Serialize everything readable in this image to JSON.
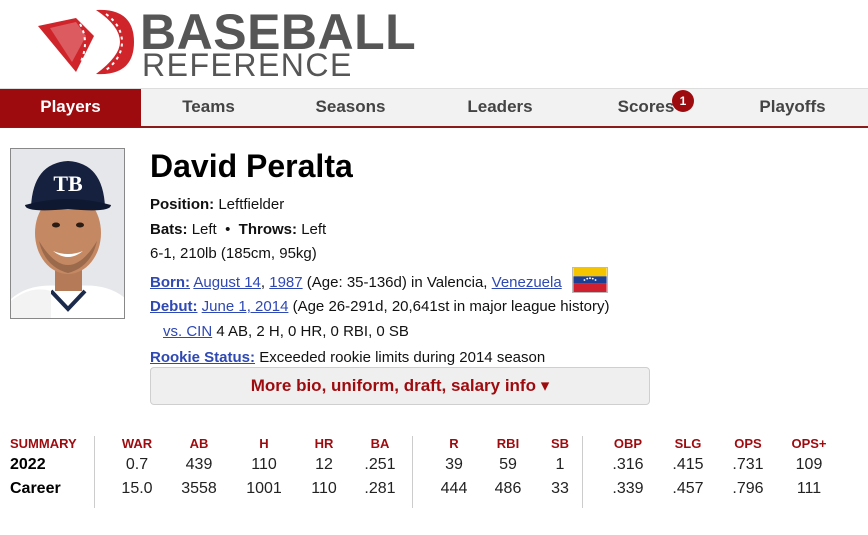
{
  "logo": {
    "line1": "BASEBALL",
    "line2": "REFERENCE",
    "brand_color": "#d0242b"
  },
  "nav": {
    "items": [
      {
        "label": "Players"
      },
      {
        "label": "Teams"
      },
      {
        "label": "Seasons"
      },
      {
        "label": "Leaders"
      },
      {
        "label": "Scores",
        "badge": "1"
      },
      {
        "label": "Playoffs"
      }
    ]
  },
  "player": {
    "name": "David Peralta",
    "position_label": "Position:",
    "position": "Leftfielder",
    "bats_label": "Bats:",
    "bats": "Left",
    "separator": "•",
    "throws_label": "Throws:",
    "throws": "Left",
    "size": "6-1, 210lb (185cm, 95kg)",
    "born_label": "Born:",
    "born_date": "August 14",
    "born_year": "1987",
    "born_age": "(Age: 35-136d) in Valencia,",
    "born_country": "Venezuela",
    "debut_label": "Debut:",
    "debut_date": "June 1, 2014",
    "debut_info": "(Age 26-291d, 20,641st in major league history)",
    "debut_opponent": "vs. CIN",
    "debut_line": "4 AB, 2 H, 0 HR, 0 RBI, 0 SB",
    "rookie_label": "Rookie Status:",
    "rookie_status": "Exceeded rookie limits during 2014 season",
    "photo_icon": "player-headshot",
    "flag_icon": "venezuela-flag"
  },
  "more_button": {
    "label": "More bio, uniform, draft, salary info ▾"
  },
  "summary": {
    "headers": [
      "SUMMARY",
      "WAR",
      "AB",
      "H",
      "HR",
      "BA",
      "R",
      "RBI",
      "SB",
      "OBP",
      "SLG",
      "OPS",
      "OPS+"
    ],
    "rows": [
      {
        "label": "2022",
        "values": [
          "0.7",
          "439",
          "110",
          "12",
          ".251",
          "39",
          "59",
          "1",
          ".316",
          ".415",
          ".731",
          "109"
        ]
      },
      {
        "label": "Career",
        "values": [
          "15.0",
          "3558",
          "1001",
          "110",
          ".281",
          "444",
          "486",
          "33",
          ".339",
          ".457",
          ".796",
          "111"
        ]
      }
    ]
  },
  "colors": {
    "accent": "#9e0b0f",
    "link": "#2e48b4",
    "nav_bg": "#f2f2f2"
  }
}
